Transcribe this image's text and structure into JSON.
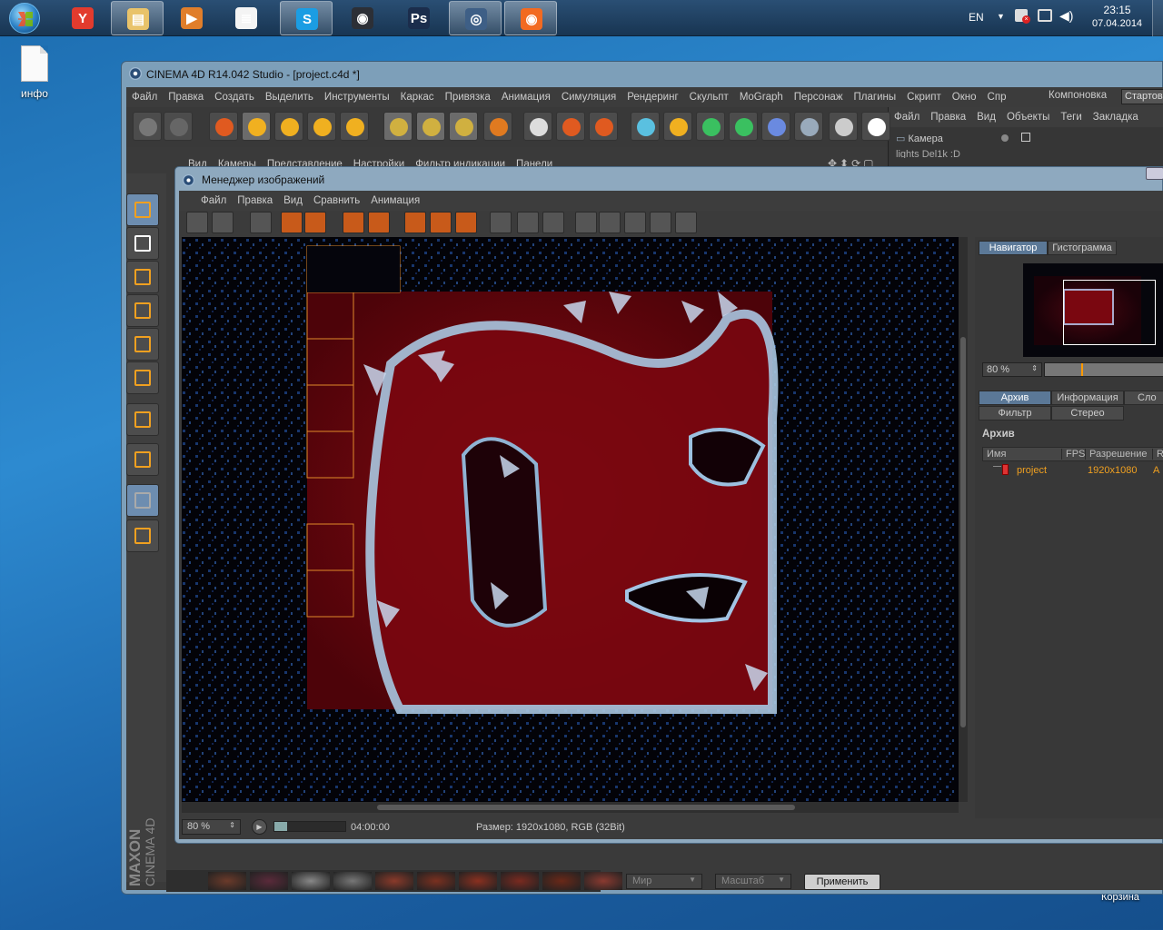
{
  "taskbar": {
    "start": "start-orb",
    "apps": [
      {
        "name": "yandex-browser",
        "letter": "Y",
        "color": "#e23b2e"
      },
      {
        "name": "file-explorer",
        "letter": "▤",
        "color": "#e9c36a"
      },
      {
        "name": "media-player",
        "letter": "▶",
        "color": "#e07e2b"
      },
      {
        "name": "document-viewer",
        "letter": "≣",
        "color": "#f4f4f4"
      },
      {
        "name": "skype",
        "letter": "S",
        "color": "#1b9de3"
      },
      {
        "name": "steam",
        "letter": "◉",
        "color": "#2c2f36"
      },
      {
        "name": "photoshop",
        "letter": "Ps",
        "color": "#1b2d4c"
      },
      {
        "name": "cinema4d",
        "letter": "◎",
        "color": "#3e5f86"
      },
      {
        "name": "origin",
        "letter": "◉",
        "color": "#f26a21"
      }
    ],
    "lang": "EN",
    "time": "23:15",
    "date": "07.04.2014"
  },
  "desktop": {
    "icon_label": "инфо",
    "recycle_label": "Корзина"
  },
  "c4d": {
    "title": "CINEMA 4D R14.042 Studio - [project.c4d *]",
    "menu": [
      "Файл",
      "Правка",
      "Создать",
      "Выделить",
      "Инструменты",
      "Каркас",
      "Привязка",
      "Анимация",
      "Симуляция",
      "Рендеринг",
      "Скульпт",
      "MoGraph",
      "Персонаж",
      "Плагины",
      "Скрипт",
      "Окно",
      "Спр"
    ],
    "layout_label": "Компоновка",
    "layout_value": "Стартов",
    "viewport_menu": [
      "Вид",
      "Камеры",
      "Представление",
      "Настройки",
      "Фильтр индикации",
      "Панели"
    ],
    "objects_menu": [
      "Файл",
      "Правка",
      "Вид",
      "Объекты",
      "Теги",
      "Закладка"
    ],
    "objects": [
      "Камера",
      "lights Del1k :D"
    ],
    "side_brand_1": "MAXON",
    "side_brand_2": "CINEMA 4D",
    "bottom": {
      "coord_mode": "Мир",
      "scale_mode": "Масштаб",
      "apply": "Применить"
    }
  },
  "image_manager": {
    "title": "Менеджер изображений",
    "menu": [
      "Файл",
      "Правка",
      "Вид",
      "Сравнить",
      "Анимация"
    ],
    "nav_tabs": [
      "Навигатор",
      "Гистограмма"
    ],
    "nav_zoom": "80 %",
    "info_tabs": [
      "Архив",
      "Информация",
      "Сло"
    ],
    "info_tabs2": [
      "Фильтр",
      "Стерео"
    ],
    "archive_header": "Архив",
    "columns": [
      "Имя",
      "FPS",
      "Разрешение",
      "R"
    ],
    "rows": [
      {
        "name": "project",
        "fps": "",
        "resolution": "1920x1080",
        "r": "A"
      }
    ],
    "zoom": "80 %",
    "timecode": "04:00:00",
    "size_info": "Размер: 1920x1080, RGB (32Bit)"
  }
}
